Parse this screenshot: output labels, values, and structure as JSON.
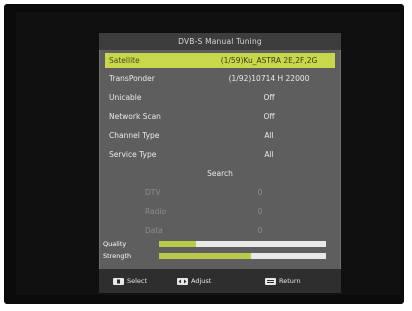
{
  "menu": {
    "title": "DVB-S Manual Tuning",
    "rows": [
      {
        "label": "Satellite",
        "value": "(1/59)Ku_ASTRA 2E,2F,2G"
      },
      {
        "label": "TransPonder",
        "value": "(1/92)10714 H 22000"
      },
      {
        "label": "Unicable",
        "value": "Off"
      },
      {
        "label": "Network Scan",
        "value": "Off"
      },
      {
        "label": "Channel Type",
        "value": "All"
      },
      {
        "label": "Service Type",
        "value": "All"
      }
    ],
    "search_label": "Search",
    "results": [
      {
        "label": "DTV",
        "value": "0"
      },
      {
        "label": "Radio",
        "value": "0"
      },
      {
        "label": "Data",
        "value": "0"
      }
    ]
  },
  "signal": {
    "quality_label": "Quality",
    "strength_label": "Strength",
    "quality_level": 0.22,
    "strength_level": 0.55
  },
  "footer": {
    "select_label": "Select",
    "adjust_label": "Adjust",
    "return_label": "Return"
  },
  "colors": {
    "highlight": "#c9d74a",
    "panel": "#5e5e5e",
    "bar_fill": "#b9c94a"
  },
  "icons": {
    "select": "select-key-icon",
    "adjust": "left-right-key-icon",
    "return": "menu-key-icon"
  }
}
